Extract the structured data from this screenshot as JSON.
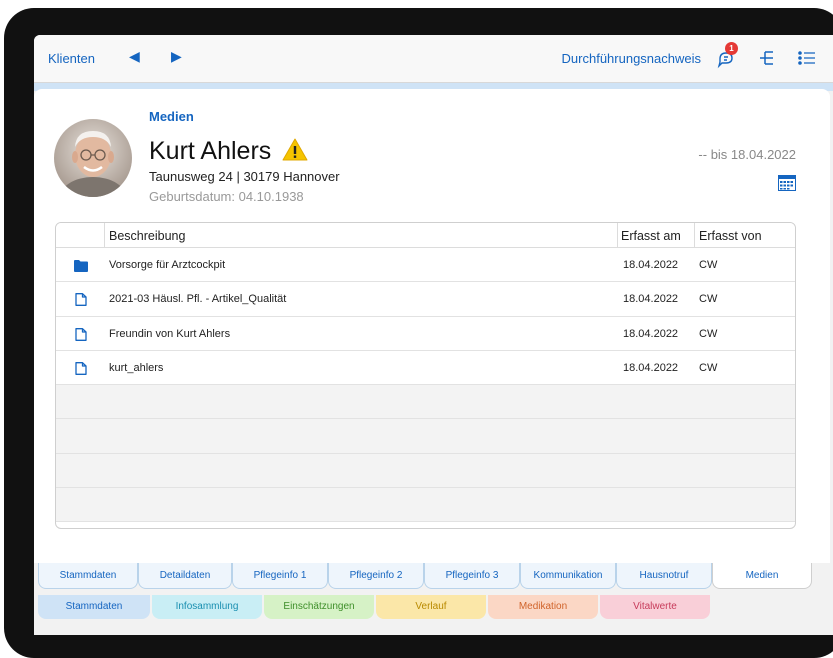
{
  "nav": {
    "back_label": "Klienten",
    "prev_icon": "triangle-left-icon",
    "next_icon": "triangle-right-icon",
    "right_title": "Durchführungsnachweis",
    "notification_count": "1"
  },
  "patient": {
    "section_label": "Medien",
    "name": "Kurt Ahlers",
    "address": "Taunusweg 24 | 30179 Hannover",
    "birthdate": "Geburtsdatum: 04.10.1938",
    "date_range": "-- bis 18.04.2022"
  },
  "table": {
    "headers": {
      "description": "Beschreibung",
      "recorded_on": "Erfasst am",
      "recorded_by": "Erfasst von"
    },
    "rows": [
      {
        "icon": "folder-icon",
        "description": "Vorsorge für Arztcockpit",
        "date": "18.04.2022",
        "by": "CW"
      },
      {
        "icon": "document-icon",
        "description": "2021-03 Häusl. Pfl. - Artikel_Qualität",
        "date": "18.04.2022",
        "by": "CW"
      },
      {
        "icon": "document-icon",
        "description": "Freundin von Kurt Ahlers",
        "date": "18.04.2022",
        "by": "CW"
      },
      {
        "icon": "document-icon",
        "description": "kurt_ahlers",
        "date": "18.04.2022",
        "by": "CW"
      }
    ]
  },
  "tabs_top": [
    "Stammdaten",
    "Detaildaten",
    "Pflegeinfo 1",
    "Pflegeinfo 2",
    "Pflegeinfo 3",
    "Kommunikation",
    "Hausnotruf",
    "Medien"
  ],
  "tabs_top_active": "Medien",
  "tabs_bottom": [
    "Stammdaten",
    "Infosammlung",
    "Einschätzungen",
    "Verlauf",
    "Medikation",
    "Vitalwerte"
  ],
  "colors": {
    "accent": "#1565c0",
    "warning": "#f5c400",
    "badge": "#e53935",
    "tab_bottom_stammdaten": "#cfe3f6",
    "tab_bottom_infosammlung": "#c9eef5",
    "tab_bottom_einschaetzungen": "#d6f2c6",
    "tab_bottom_verlauf": "#fbe7a8",
    "tab_bottom_medikation": "#fbd7c5",
    "tab_bottom_vitalwerte": "#f9cfd8"
  }
}
